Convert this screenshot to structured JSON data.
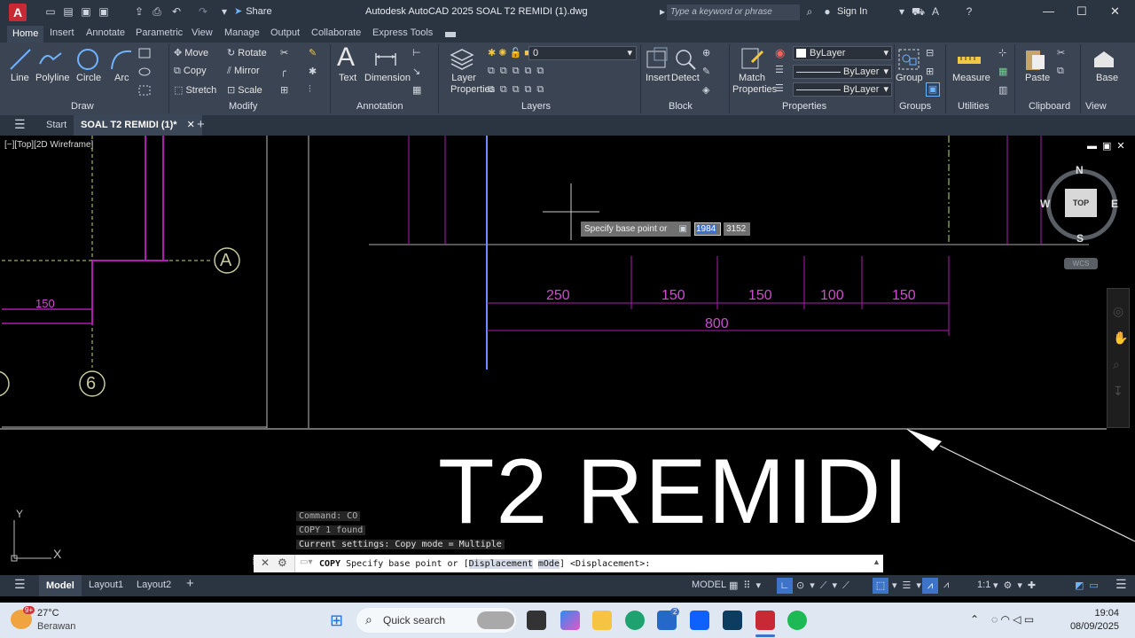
{
  "titlebar": {
    "app_letter": "A",
    "share": "Share",
    "title": "Autodesk AutoCAD 2025   SOAL T2 REMIDI (1).dwg",
    "search_placeholder": "Type a keyword or phrase",
    "signin": "Sign In"
  },
  "ribbon_tabs": [
    "Home",
    "Insert",
    "Annotate",
    "Parametric",
    "View",
    "Manage",
    "Output",
    "Collaborate",
    "Express Tools"
  ],
  "panels": {
    "draw": {
      "title": "Draw",
      "tools": [
        "Line",
        "Polyline",
        "Circle",
        "Arc"
      ]
    },
    "modify": {
      "title": "Modify",
      "tools": [
        "Move",
        "Rotate",
        "Copy",
        "Mirror",
        "Stretch",
        "Scale"
      ]
    },
    "annotation": {
      "title": "Annotation",
      "tools": [
        "Text",
        "Dimension"
      ]
    },
    "layers": {
      "title": "Layers",
      "tool": "Layer Properties",
      "current_layer": "0"
    },
    "block": {
      "title": "Block",
      "tools": [
        "Insert",
        "Detect"
      ]
    },
    "properties": {
      "title": "Properties",
      "tool": "Match Properties",
      "color": "ByLayer",
      "linetype": "ByLayer",
      "lineweight": "ByLayer"
    },
    "groups": {
      "title": "Groups",
      "tool": "Group"
    },
    "utilities": {
      "title": "Utilities",
      "tool": "Measure"
    },
    "clipboard": {
      "title": "Clipboard",
      "tool": "Paste"
    },
    "view": {
      "title": "View",
      "tool": "Base"
    }
  },
  "doc_tabs": {
    "start": "Start",
    "active": "SOAL T2 REMIDI (1)*",
    "add": "+"
  },
  "viewport": {
    "label": "[−][Top][2D Wireframe]",
    "viewcube": {
      "top": "TOP",
      "n": "N",
      "s": "S",
      "e": "E",
      "w": "W",
      "wcs": "WCS"
    }
  },
  "drawing": {
    "dims": [
      "250",
      "150",
      "150",
      "100",
      "150"
    ],
    "total": "800",
    "left_dim": "150",
    "bubble_a": "A",
    "bubble_6": "6",
    "big_title": "T2 REMIDI",
    "ucs_x": "X",
    "ucs_y": "Y"
  },
  "dynamic_input": {
    "prompt": "Specify base point or",
    "x": "1984",
    "y": "3152"
  },
  "command": {
    "history": [
      "Command: CO",
      "COPY 1 found",
      "Current settings:  Copy mode = Multiple"
    ],
    "name": "COPY",
    "prompt_a": "Specify base point or [",
    "opt1": "Displacement",
    "opt2": "mOde",
    "prompt_b": "] <Displacement>:"
  },
  "status": {
    "tab_model": "Model",
    "layout1": "Layout1",
    "layout2": "Layout2",
    "mode": "MODEL",
    "scale": "1:1"
  },
  "taskbar": {
    "weather_temp": "27°C",
    "weather_desc": "Berawan",
    "badge": "9+",
    "search": "Quick search",
    "time": "19:04",
    "date": "08/09/2025",
    "store_badge": "2"
  }
}
